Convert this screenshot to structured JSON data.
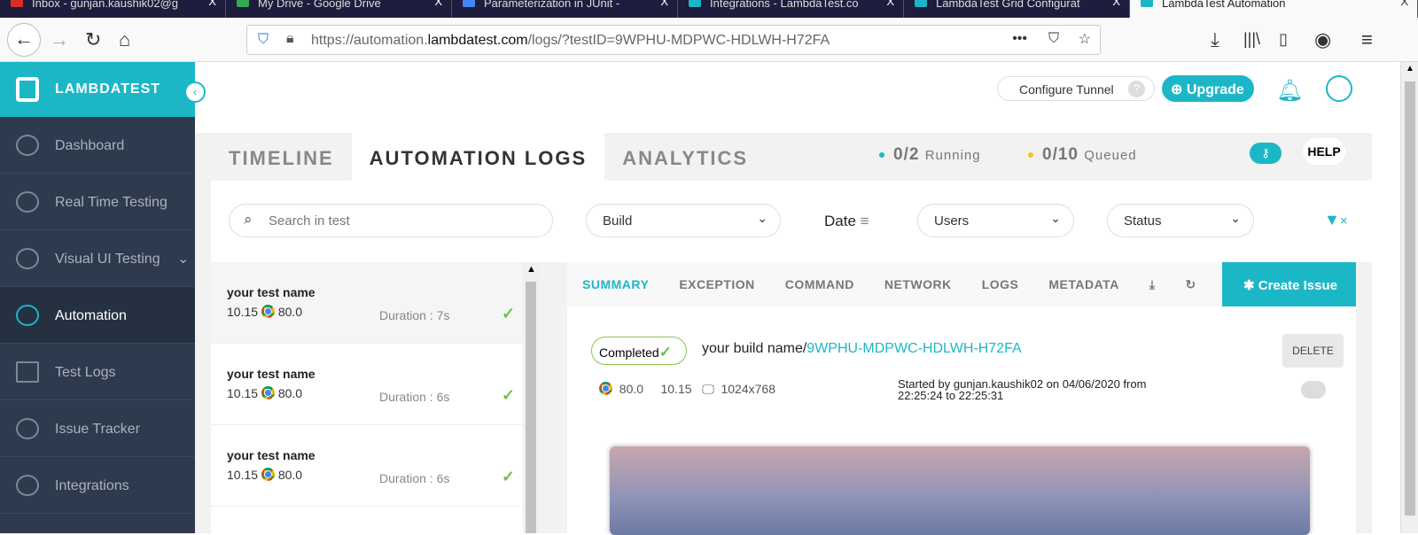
{
  "browser": {
    "tabs": [
      "Inbox - gunjan.kaushik02@g",
      "My Drive - Google Drive",
      "Parameterization in JUnit - ",
      "Integrations - LambdaTest.co",
      "LambdaTest Grid Configurat",
      "LambdaTest Automation"
    ],
    "url_prefix": "https://automation.",
    "url_domain": "lambdatest.com",
    "url_path": "/logs/?testID=9WPHU-MDPWC-HDLWH-H72FA"
  },
  "sidebar": {
    "logo": "LAMBDATEST",
    "items": [
      "Dashboard",
      "Real Time Testing",
      "Visual UI Testing",
      "Automation",
      "Test Logs",
      "Issue Tracker",
      "Integrations"
    ]
  },
  "header": {
    "tunnel": "Configure Tunnel",
    "upgrade": "Upgrade",
    "help": "HELP"
  },
  "tabs": [
    "TIMELINE",
    "AUTOMATION LOGS",
    "ANALYTICS"
  ],
  "status": {
    "running": "0/2",
    "running_label": "Running",
    "queued": "0/10",
    "queued_label": "Queued",
    "running_color": "#1cb7c7",
    "queued_color": "#f5c518"
  },
  "filters": {
    "search_placeholder": "Search in test",
    "build": "Build",
    "date": "Date",
    "users": "Users",
    "status": "Status"
  },
  "tests": [
    {
      "name": "your test name",
      "os": "10.15",
      "browser": "80.0",
      "duration": "Duration : 7s"
    },
    {
      "name": "your test name",
      "os": "10.15",
      "browser": "80.0",
      "duration": "Duration : 6s"
    },
    {
      "name": "your test name",
      "os": "10.15",
      "browser": "80.0",
      "duration": "Duration : 6s"
    }
  ],
  "detail": {
    "tabs": [
      "SUMMARY",
      "EXCEPTION",
      "COMMAND",
      "NETWORK",
      "LOGS",
      "METADATA"
    ],
    "create_issue": "Create Issue",
    "status": "Completed",
    "build_name": "your build name/",
    "test_id": "9WPHU-MDPWC-HDLWH-H72FA",
    "delete": "DELETE",
    "browser": "80.0",
    "os": "10.15",
    "resolution": "1024x768",
    "started": "Started by gunjan.kaushik02 on 04/06/2020 from 22:25:24 to 22:25:31"
  }
}
